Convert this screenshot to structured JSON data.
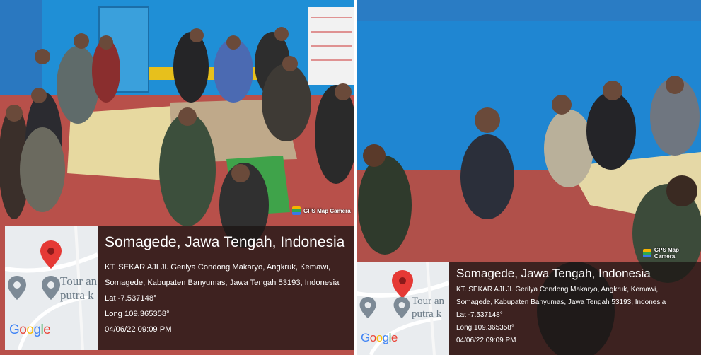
{
  "left_photo": {
    "badge": {
      "icon": "gps-map-camera-icon",
      "label": "GPS Map Camera"
    },
    "stamp": {
      "place": "Somagede, Jawa Tengah, Indonesia",
      "address_line1": "KT. SEKAR AJI Jl. Gerilya Condong Makaryo, Angkruk, Kemawi,",
      "address_line2": "Somagede, Kabupaten Banyumas, Jawa Tengah 53193, Indonesia",
      "lat": "Lat -7.537148°",
      "long": "Long 109.365358°",
      "datetime": "04/06/22 09:09 PM"
    },
    "map": {
      "poi_line1": "Tour an",
      "poi_line2": "putra k",
      "logo": "Google"
    }
  },
  "right_photo": {
    "badge": {
      "icon": "gps-map-camera-icon",
      "label": "GPS Map Camera"
    },
    "stamp": {
      "place": "Somagede, Jawa Tengah, Indonesia",
      "address_line1": "KT. SEKAR AJI Jl. Gerilya Condong Makaryo, Angkruk, Kemawi,",
      "address_line2": "Somagede, Kabupaten Banyumas, Jawa Tengah 53193, Indonesia",
      "lat": "Lat -7.537148°",
      "long": "Long 109.365358°",
      "datetime": "04/06/22 09:09 PM"
    },
    "map": {
      "poi_line1": "Tour an",
      "poi_line2": "putra k",
      "logo": "Google"
    }
  },
  "colors": {
    "wall_blue": "#1f8fd6",
    "floor_red": "#b8504a",
    "map_pin": "#e53935",
    "stamp_bg": "#1c1614"
  }
}
